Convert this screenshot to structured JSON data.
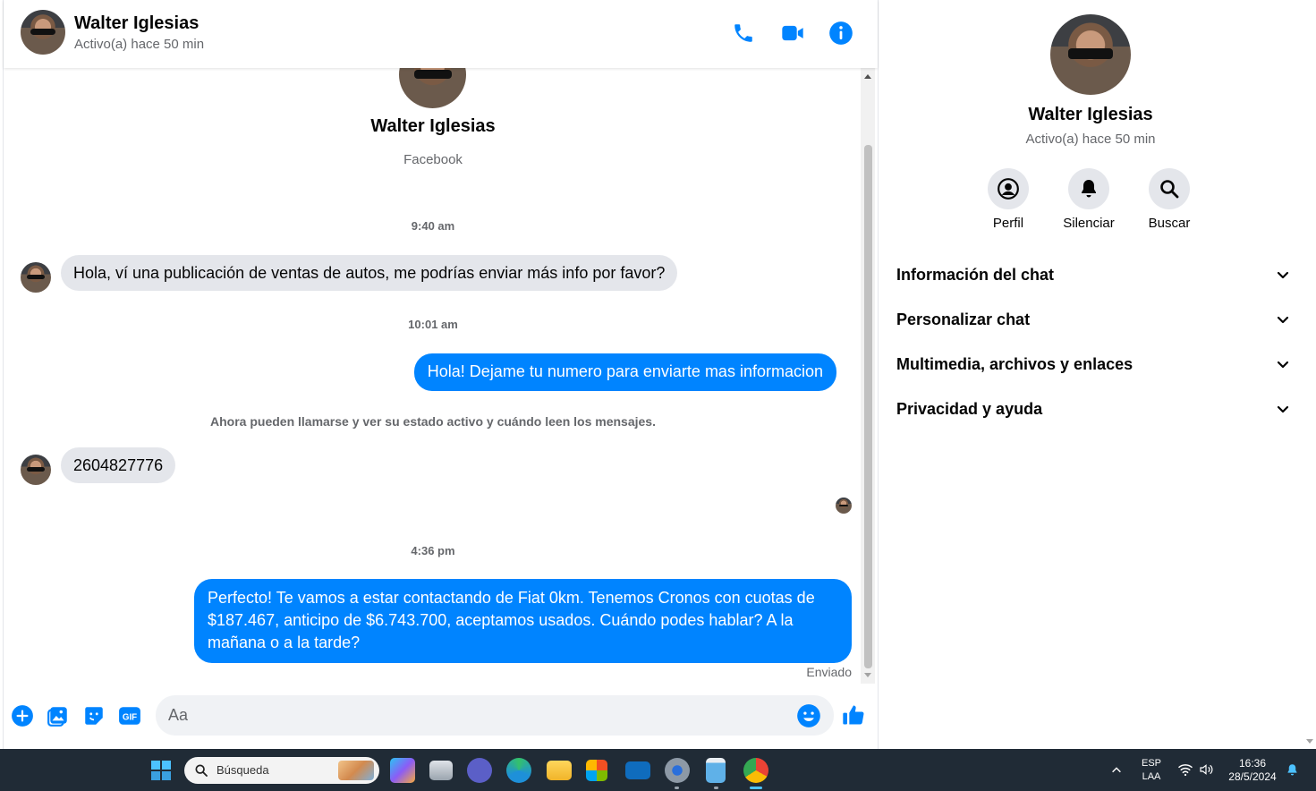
{
  "colors": {
    "accent": "#0084ff",
    "incoming_bubble": "#e4e6eb",
    "secondary_text": "#65676b",
    "taskbar": "#202b36"
  },
  "header": {
    "name": "Walter Iglesias",
    "status": "Activo(a) hace 50 min",
    "icons": [
      "phone-icon",
      "video-camera-icon",
      "info-icon"
    ]
  },
  "conversation": {
    "intro_name": "Walter Iglesias",
    "intro_source": "Facebook",
    "time_1": "9:40 am",
    "msg_in_1": "Hola, ví una publicación de ventas de autos, me podrías enviar más info por favor?",
    "time_2": "10:01 am",
    "msg_out_1": "Hola! Dejame tu numero para enviarte mas informacion",
    "system_notice": "Ahora pueden llamarse y ver su estado activo y cuándo leen los mensajes.",
    "msg_in_2": "2604827776",
    "time_3": "4:36 pm",
    "msg_out_2": "Perfecto! Te vamos a estar contactando de Fiat 0km. Tenemos Cronos con cuotas de $187.467, anticipo de $6.743.700, aceptamos usados. Cuándo podes hablar? A la mañana o a la tarde?",
    "sent_status": "Enviado"
  },
  "composer": {
    "placeholder": "Aa",
    "value": "",
    "icons": [
      "add-circle-icon",
      "photo-icon",
      "sticker-icon",
      "gif-icon",
      "emoji-icon",
      "thumbs-up-icon"
    ],
    "gif_label": "GIF"
  },
  "info_panel": {
    "name": "Walter Iglesias",
    "status": "Activo(a) hace 50 min",
    "actions": [
      {
        "label": "Perfil",
        "icon": "profile-icon"
      },
      {
        "label": "Silenciar",
        "icon": "bell-icon"
      },
      {
        "label": "Buscar",
        "icon": "search-icon"
      }
    ],
    "sections": [
      {
        "label": "Información del chat"
      },
      {
        "label": "Personalizar chat"
      },
      {
        "label": "Multimedia, archivos y enlaces"
      },
      {
        "label": "Privacidad y ayuda"
      }
    ]
  },
  "taskbar": {
    "search_placeholder": "Búsqueda",
    "apps": [
      "windows-start-icon",
      "copilot-icon",
      "task-view-icon",
      "teams-icon",
      "edge-icon",
      "file-explorer-icon",
      "store-icon",
      "mail-icon",
      "settings-icon",
      "notepad-icon",
      "chrome-icon"
    ],
    "language_top": "ESP",
    "language_bottom": "LAA",
    "time": "16:36",
    "date": "28/5/2024"
  }
}
